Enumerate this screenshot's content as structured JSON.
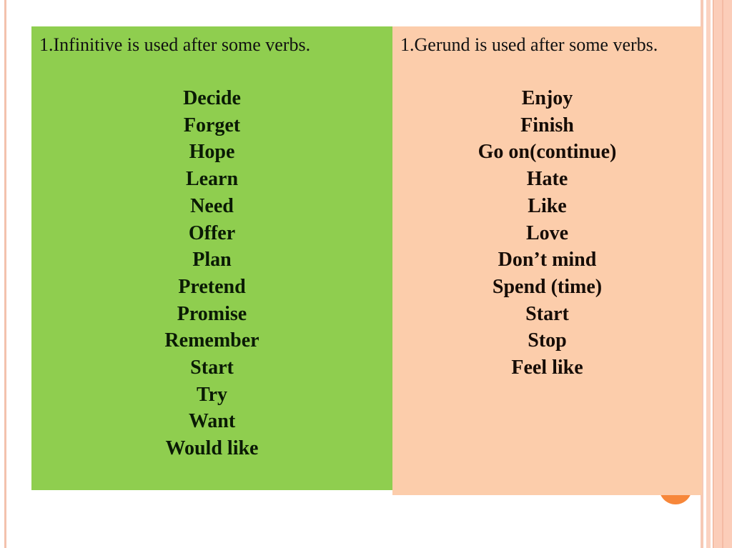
{
  "colors": {
    "infinitive_panel": "#8fce4f",
    "gerund_panel": "#fccdab",
    "accent_orange": "#f7873a",
    "decor_stripe": "#fbcdb9"
  },
  "infinitive": {
    "heading": "1.Infinitive is used after some verbs.",
    "verbs": [
      "Decide",
      "Forget",
      "Hope",
      "Learn",
      "Need",
      "Offer",
      "Plan",
      "Pretend",
      "Promise",
      "Remember",
      "Start",
      "Try",
      "Want",
      "Would like"
    ]
  },
  "gerund": {
    "heading": "1.Gerund is used after some verbs.",
    "verbs": [
      "Enjoy",
      "Finish",
      "Go on(continue)",
      "Hate",
      "Like",
      "Love",
      "Don’t mind",
      "Spend (time)",
      "Start",
      "Stop",
      "Feel like"
    ]
  }
}
